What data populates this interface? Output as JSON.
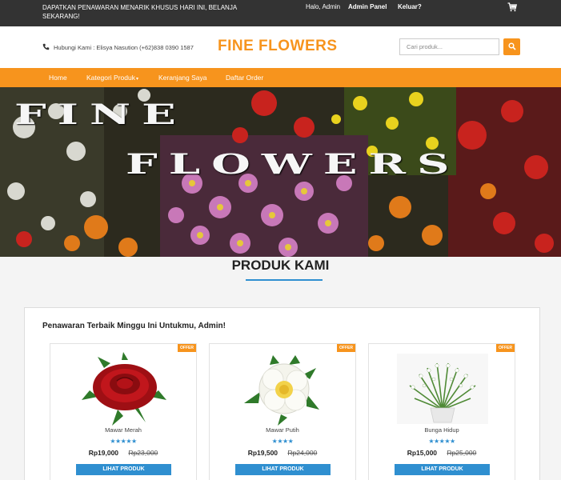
{
  "topbar": {
    "promo": "DAPATKAN PENAWARAN MENARIK KHUSUS HARI INI, BELANJA SEKARANG!",
    "greeting": "Halo, Admin",
    "admin_panel": "Admin Panel",
    "logout": "Keluar?",
    "cart_icon": "cart-icon"
  },
  "header": {
    "contact": "Hubungi Kami : Elisya Nasution (+62)838 0390 1587",
    "brand": "FINE FLOWERS",
    "search_placeholder": "Cari produk...",
    "search_icon": "search-icon"
  },
  "nav": {
    "items": [
      "Home",
      "Kategori Produk",
      "Keranjang Saya",
      "Daftar Order"
    ],
    "dropdown_icon": "caret-down-icon"
  },
  "hero": {
    "line1": "FINE",
    "line2": "FLOWERS"
  },
  "section": {
    "title": "PRODUK KAMI"
  },
  "offers": {
    "title": "Penawaran Terbaik Minggu Ini Untukmu, Admin!",
    "products": [
      {
        "badge": "OFFER",
        "name": "Mawar Merah",
        "rating": 5,
        "stars": "★★★★★",
        "price": "Rp19,000",
        "old_price": "Rp23,000",
        "button": "LIHAT PRODUK"
      },
      {
        "badge": "OFFER",
        "name": "Mawar Putih",
        "rating": 4,
        "stars": "★★★★",
        "price": "Rp19,500",
        "old_price": "Rp24,000",
        "button": "LIHAT PRODUK"
      },
      {
        "badge": "OFFER",
        "name": "Bunga Hidup",
        "rating": 5,
        "stars": "★★★★★",
        "price": "Rp15,000",
        "old_price": "Rp25,000",
        "button": "LIHAT PRODUK"
      }
    ]
  },
  "colors": {
    "accent": "#f7941d",
    "topbar": "#333333",
    "button": "#2f8fd0",
    "stars": "#2f8fd0"
  }
}
